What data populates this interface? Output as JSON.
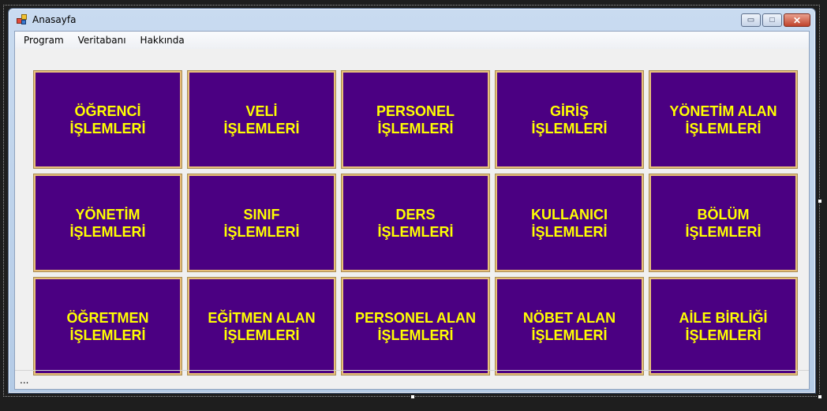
{
  "window": {
    "title": "Anasayfa",
    "controls": {
      "minimize": "▭",
      "maximize": "□",
      "close": "✕"
    }
  },
  "menu": {
    "items": [
      "Program",
      "Veritabanı",
      "Hakkında"
    ]
  },
  "colors": {
    "tile_background": "#4B0082",
    "tile_text": "#FFFF00"
  },
  "tiles": [
    {
      "line1": "ÖĞRENCİ",
      "line2": "İŞLEMLERİ"
    },
    {
      "line1": "VELİ",
      "line2": "İŞLEMLERİ"
    },
    {
      "line1": "PERSONEL",
      "line2": "İŞLEMLERİ"
    },
    {
      "line1": "GİRİŞ",
      "line2": "İŞLEMLERİ"
    },
    {
      "line1": "YÖNETİM ALAN",
      "line2": "İŞLEMLERİ"
    },
    {
      "line1": "YÖNETİM",
      "line2": "İŞLEMLERİ"
    },
    {
      "line1": "SINIF",
      "line2": "İŞLEMLERİ"
    },
    {
      "line1": "DERS",
      "line2": "İŞLEMLERİ"
    },
    {
      "line1": "KULLANICI",
      "line2": "İŞLEMLERİ"
    },
    {
      "line1": "BÖLÜM",
      "line2": "İŞLEMLERİ"
    },
    {
      "line1": "ÖĞRETMEN",
      "line2": "İŞLEMLERİ"
    },
    {
      "line1": "EĞİTMEN ALAN",
      "line2": "İŞLEMLERİ"
    },
    {
      "line1": "PERSONEL ALAN",
      "line2": "İŞLEMLERİ"
    },
    {
      "line1": "NÖBET ALAN",
      "line2": "İŞLEMLERİ"
    },
    {
      "line1": "AİLE BİRLİĞİ",
      "line2": "İŞLEMLERİ"
    }
  ],
  "statusbar": {
    "text": "..."
  }
}
